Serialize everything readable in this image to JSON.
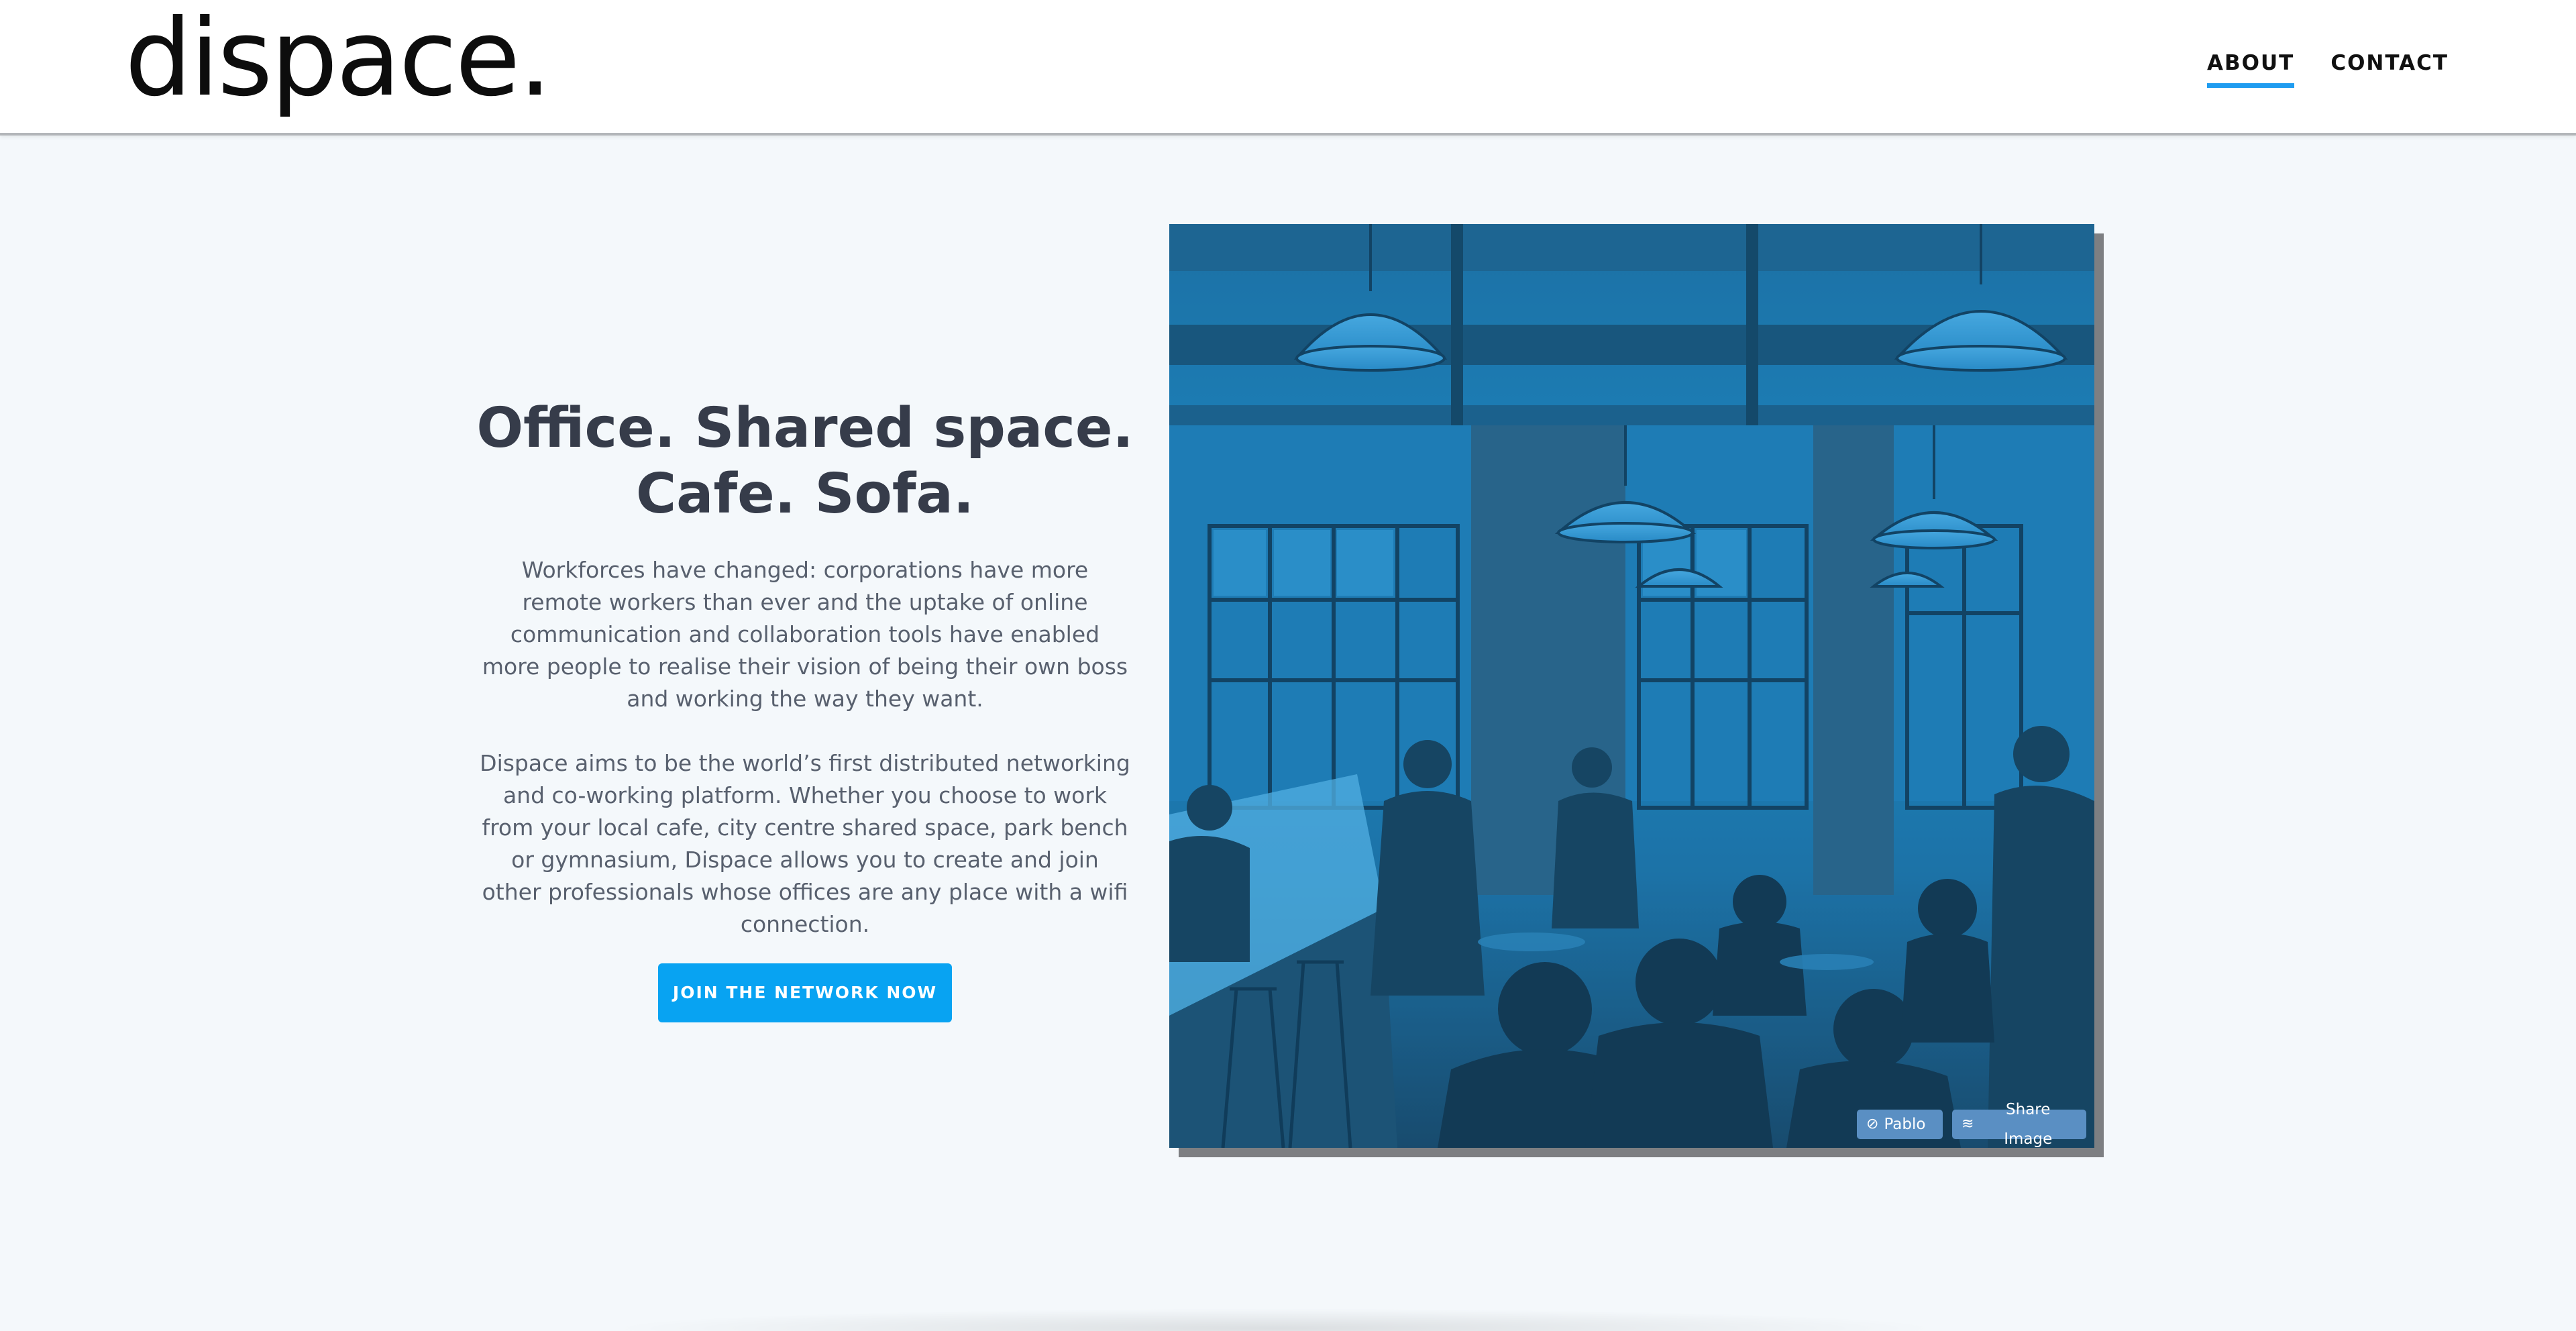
{
  "header": {
    "logo": "dispace.",
    "nav": [
      {
        "label": "ABOUT",
        "active": true
      },
      {
        "label": "CONTACT",
        "active": false
      }
    ]
  },
  "hero": {
    "title_line1": "Office. Shared space.",
    "title_line2": "Cafe. Sofa.",
    "paragraph1": "Workforces have changed: corporations have more remote workers than ever and the uptake of online communication and collaboration tools have enabled more people to realise their vision of being their own boss and working the way they want.",
    "paragraph2": "Dispace aims to be the world’s first distributed networking and co-working platform. Whether you choose to work from your local cafe, city centre shared space, park bench or gymnasium, Dispace allows you to create and join other professionals whose offices are any place with a wifi connection.",
    "cta_label": "JOIN THE NETWORK NOW"
  },
  "photo": {
    "overlay_buttons": {
      "pablo_label": "Pablo",
      "share_label": "Share Image"
    },
    "tint_color": "#1f86c0"
  },
  "colors": {
    "accent": "#08a3f2",
    "nav_underline": "#1f9cf0",
    "heading": "#363c4a",
    "body_text": "#58606e",
    "page_bg": "#f4f8fb"
  }
}
